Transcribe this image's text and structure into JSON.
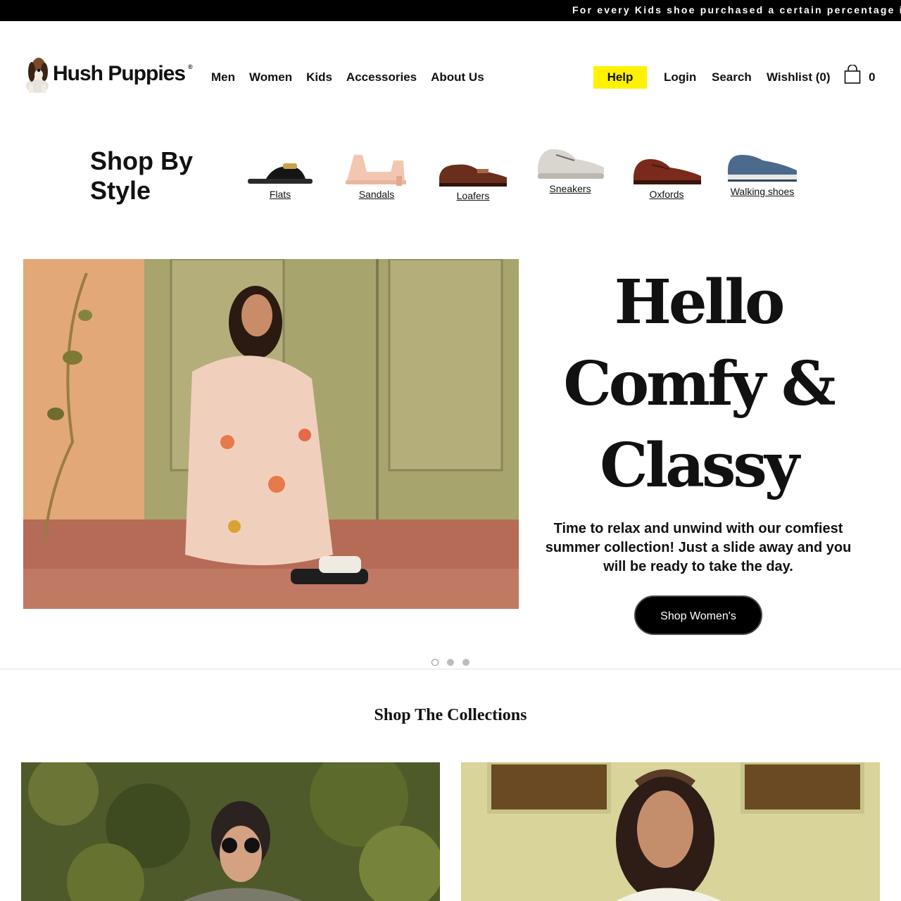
{
  "announcement": "For every Kids shoe purchased a certain percentage i",
  "brand": {
    "name": "Hush Puppies",
    "reg": "®",
    "logo_icon": "basset-hound-logo"
  },
  "nav": [
    {
      "label": "Men"
    },
    {
      "label": "Women"
    },
    {
      "label": "Kids"
    },
    {
      "label": "Accessories"
    },
    {
      "label": "About Us"
    }
  ],
  "utility": {
    "help": "Help",
    "login": "Login",
    "search": "Search",
    "wishlist": "Wishlist (0)",
    "cart_icon": "shopping-bag-icon",
    "cart_count": "0",
    "help_color": "#fff200"
  },
  "shop_by_style": {
    "title": "Shop By Style",
    "items": [
      {
        "label": "Flats"
      },
      {
        "label": "Sandals"
      },
      {
        "label": "Loafers"
      },
      {
        "label": "Sneakers"
      },
      {
        "label": "Oxfords"
      },
      {
        "label": "Walking shoes"
      }
    ]
  },
  "hero": {
    "title_line1": "Hello",
    "title_line2": "Comfy &",
    "title_line3": "Classy",
    "subtitle": "Time to relax and unwind with our comfiest summer collection! Just a slide away and you will be ready to take the day.",
    "cta": "Shop Women's",
    "slides_total": 3,
    "active_slide": 1
  },
  "collections": {
    "title": "Shop The Collections"
  }
}
